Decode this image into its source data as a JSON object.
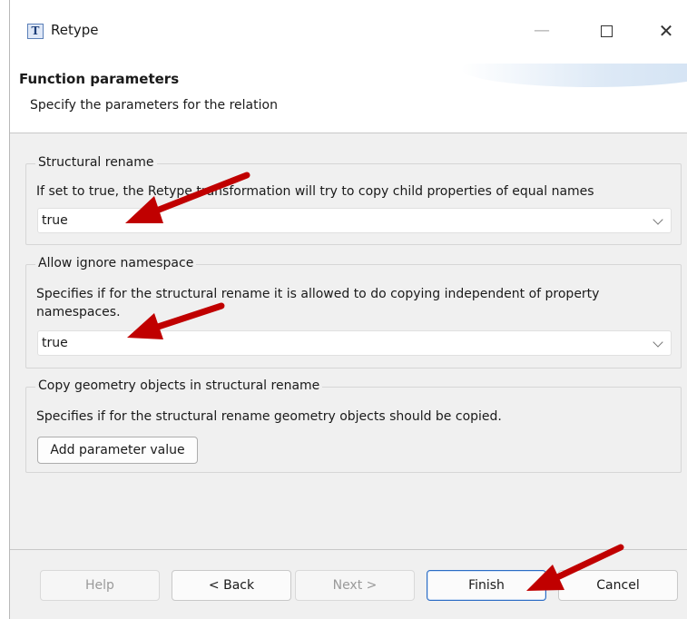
{
  "window": {
    "title": "Retype",
    "icon_letter": "T",
    "controls": {
      "minimize": "—",
      "maximize": "maximize-icon",
      "close": "✕"
    }
  },
  "header": {
    "title": "Function parameters",
    "subtitle": "Specify the parameters for the relation"
  },
  "groups": [
    {
      "title": "Structural rename",
      "description": "If set to true, the Retype transformation will try to copy child properties of equal names",
      "select_value": "true"
    },
    {
      "title": "Allow ignore namespace",
      "description_line1": "Specifies if for the structural rename it is allowed to do copying independent of property",
      "description_line2": "namespaces.",
      "select_value": "true"
    },
    {
      "title": "Copy geometry objects in structural rename",
      "description": "Specifies if for the structural rename geometry objects should be copied.",
      "button_label": "Add parameter value"
    }
  ],
  "footer": {
    "help": "Help",
    "back": "< Back",
    "next": "Next >",
    "finish": "Finish",
    "cancel": "Cancel"
  },
  "colors": {
    "annotation_arrow": "#c00000",
    "primary_border": "#2b6cc4"
  }
}
